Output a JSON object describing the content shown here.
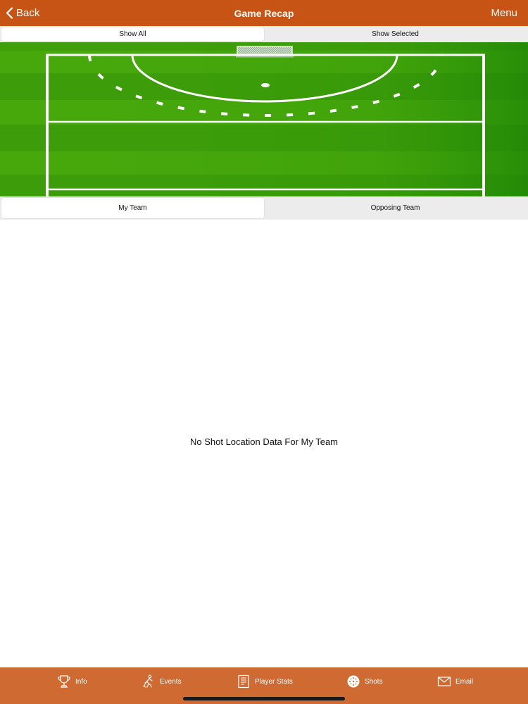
{
  "nav": {
    "back_label": "Back",
    "title": "Game Recap",
    "menu_label": "Menu"
  },
  "filter": {
    "show_all": "Show All",
    "show_selected": "Show Selected",
    "selected": "Show All"
  },
  "team": {
    "my_team": "My Team",
    "opposing_team": "Opposing Team",
    "selected": "My Team"
  },
  "empty_message": "No Shot Location Data For My Team",
  "tabs": [
    {
      "label": "Info",
      "icon": "trophy-icon"
    },
    {
      "label": "Events",
      "icon": "hockey-player-icon"
    },
    {
      "label": "Player Stats",
      "icon": "scoresheet-icon"
    },
    {
      "label": "Shots",
      "icon": "ball-icon"
    },
    {
      "label": "Email",
      "icon": "envelope-icon"
    }
  ],
  "colors": {
    "nav_bar": "#c75415",
    "tab_bar": "#cf6a33",
    "field_green": "#3a9e0d",
    "field_line": "#ffffff"
  }
}
